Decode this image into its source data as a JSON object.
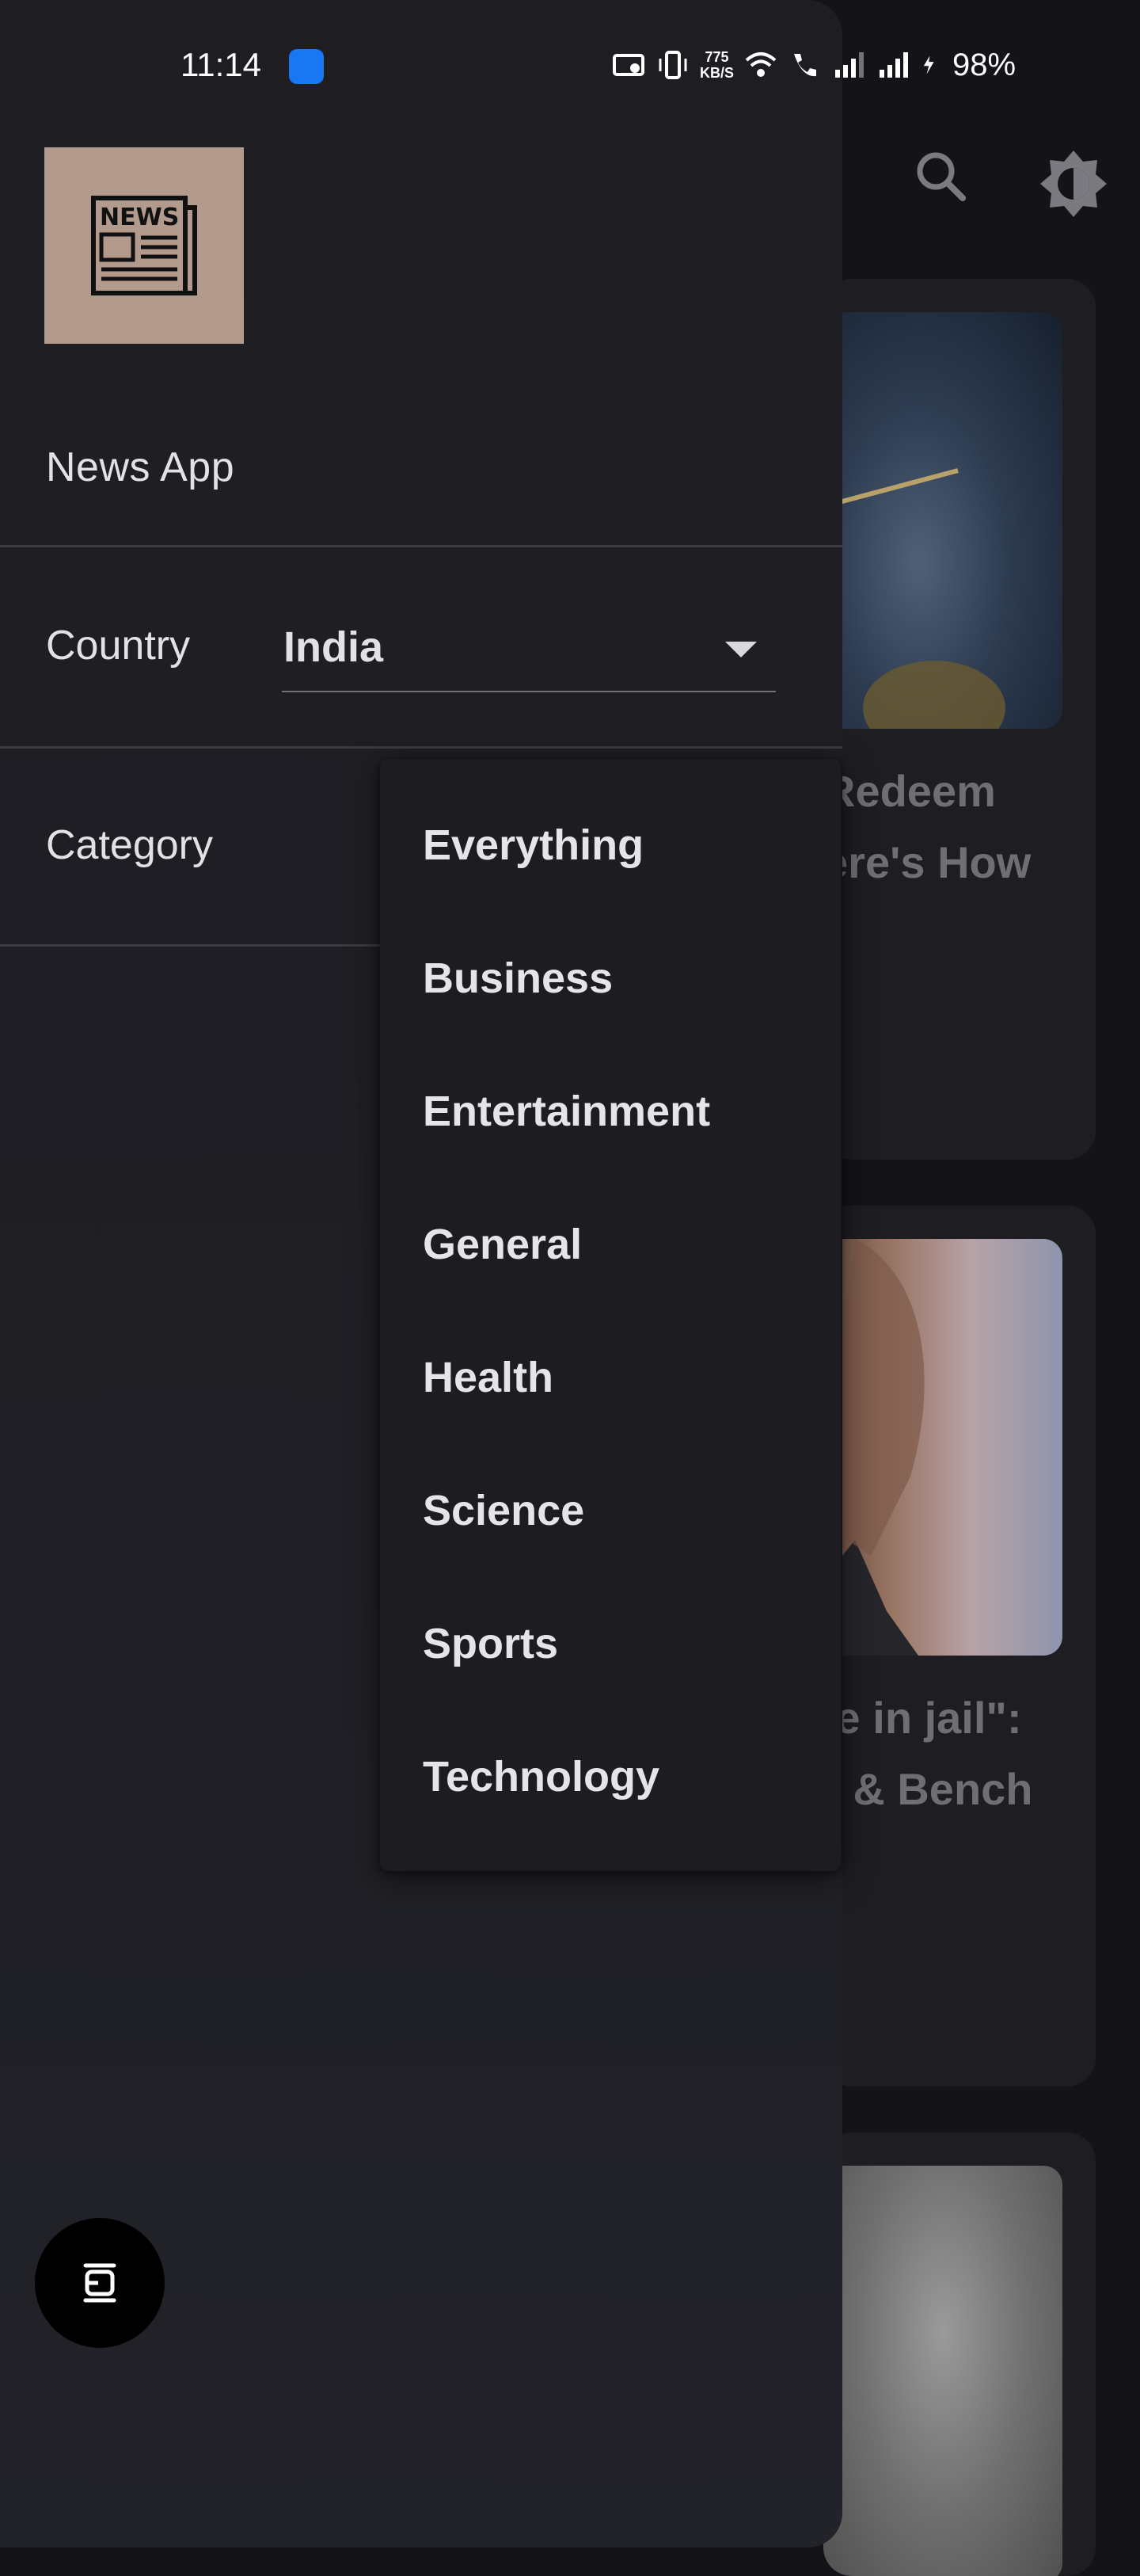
{
  "status_bar": {
    "time": "11:14",
    "network_speed_value": "775",
    "network_speed_unit": "KB/S",
    "battery": "98%",
    "icons": [
      "notification-app-icon",
      "cast-icon",
      "vibrate-icon",
      "wifi-icon",
      "wifi-call-icon",
      "signal-icon",
      "signal-icon",
      "charging-icon"
    ]
  },
  "drawer": {
    "app_name": "News App",
    "logo_icon": "newspaper-icon",
    "logo_background": "#b29a8c",
    "country": {
      "label": "Country",
      "selected": "India"
    },
    "category": {
      "label": "Category"
    }
  },
  "category_menu": {
    "items": [
      "Everything",
      "Business",
      "Entertainment",
      "General",
      "Health",
      "Science",
      "Sports",
      "Technology"
    ]
  },
  "background": {
    "toolbar_icons": [
      "search-icon",
      "brightness-icon"
    ],
    "cards": [
      {
        "title_line1": "Redeem",
        "title_line2": "ere's How"
      },
      {
        "title_line1": "ie in jail\":",
        "title_line2": "r & Bench"
      },
      {
        "title_line1": "",
        "title_line2": ""
      }
    ]
  },
  "floating_button": {
    "icon": "screenshot-capture-icon"
  },
  "colors": {
    "drawer_bg": "#1d1d22",
    "menu_bg": "#1c1c21",
    "text": "#e4e1e6"
  }
}
